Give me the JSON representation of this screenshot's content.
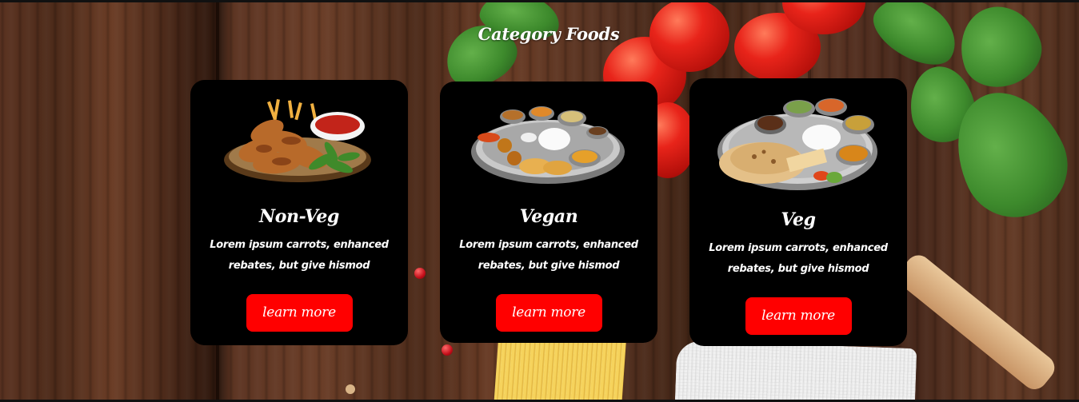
{
  "section": {
    "title": "Category Foods"
  },
  "cards": [
    {
      "title": "Non-Veg",
      "description": "Lorem ipsum carrots, enhanced rebates, but give hismod",
      "button_label": "learn more",
      "image_icon": "non-veg-plate-image"
    },
    {
      "title": "Vegan",
      "description": "Lorem ipsum carrots, enhanced rebates, but give hismod",
      "button_label": "learn more",
      "image_icon": "vegan-thali-image"
    },
    {
      "title": "Veg",
      "description": "Lorem ipsum carrots, enhanced rebates, but give hismod",
      "button_label": "learn more",
      "image_icon": "veg-thali-image"
    }
  ],
  "colors": {
    "card_background": "#000000",
    "button_background": "#ff0000",
    "text": "#ffffff",
    "wood": "#5a3220"
  }
}
